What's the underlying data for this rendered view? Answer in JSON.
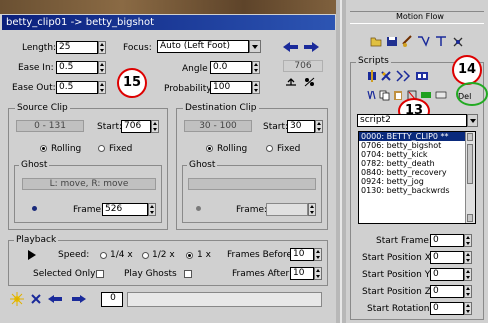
{
  "dialog": {
    "title": "betty_clip01 -> betty_bigshot",
    "length_label": "Length:",
    "length_value": "25",
    "ease_in_label": "Ease In:",
    "ease_in_value": "0.5",
    "ease_out_label": "Ease Out:",
    "ease_out_value": "0.5",
    "focus_label": "Focus:",
    "focus_value": "Auto (Left Foot)",
    "angle_label": "Angle",
    "angle_value": "0.0",
    "probability_label": "Probability",
    "probability_value": "100",
    "frame_count": "706",
    "badge_left": "15",
    "source": {
      "title": "Source Clip",
      "range": "0 - 131",
      "start_label": "Start:",
      "start_value": "706",
      "rolling": "Rolling",
      "fixed": "Fixed",
      "ghost_title": "Ghost",
      "ghost_info": "L: move, R: move",
      "frame_label": "Frame:",
      "frame_value": "526"
    },
    "dest": {
      "title": "Destination Clip",
      "range": "30 - 100",
      "start_label": "Start:",
      "start_value": "30",
      "rolling": "Rolling",
      "fixed": "Fixed",
      "ghost_title": "Ghost",
      "ghost_info": "",
      "frame_label": "Frame:",
      "frame_value": ""
    },
    "playback": {
      "title": "Playback",
      "speed_label": "Speed:",
      "speed_quarter": "1/4 x",
      "speed_half": "1/2 x",
      "speed_one": "1 x",
      "selected_only": "Selected Only",
      "play_ghosts": "Play Ghosts",
      "frames_before_label": "Frames Before:",
      "frames_before_value": "10",
      "frames_after_label": "Frames After:",
      "frames_after_value": "10"
    },
    "bottom_field_value": "0"
  },
  "panel": {
    "title": "Motion Flow",
    "scripts_title": "Scripts",
    "badge_right": "14",
    "badge_list": "13",
    "script_dropdown": "script2",
    "script_items": [
      "0000: BETTY_CLIP0 **",
      "0706: betty_bigshot",
      "0704: betty_kick",
      "0782: betty_death",
      "0840: betty_recovery",
      "0924: betty_jog",
      "0130: betty_backwrds"
    ],
    "start_frame_label": "Start Frame:",
    "start_frame_value": "0",
    "start_pos_x_label": "Start Position X:",
    "start_pos_x_value": "0",
    "start_pos_y_label": "Start Position Y:",
    "start_pos_y_value": "0",
    "start_pos_z_label": "Start Position Z:",
    "start_pos_z_value": "0",
    "start_rotation_label": "Start Rotation:",
    "start_rotation_value": "0"
  },
  "colors": {
    "title_bar": "#0a1f7c",
    "selection": "#0a2a7c",
    "badge_red": "#dd0000",
    "badge_green": "#22aa22"
  }
}
